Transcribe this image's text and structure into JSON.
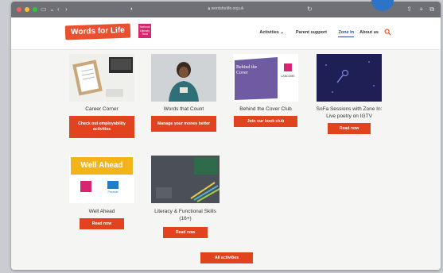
{
  "browser": {
    "url": "wordsforlife.org.uk"
  },
  "header": {
    "logo_text": "Words for Life",
    "partner_logo_text": "National Literacy Trust",
    "nav": [
      {
        "label": "Activities ⌄"
      },
      {
        "label": "Parent support"
      },
      {
        "label": "Zone In"
      },
      {
        "label": "About us"
      }
    ]
  },
  "cards": [
    {
      "caption": "Career Corner",
      "button": "Check out employability activities"
    },
    {
      "caption": "Words that Count",
      "button": "Manage your money better"
    },
    {
      "caption": "Behind the Cover Club",
      "button": "Join our book club",
      "thumb_text": "Behind the Cover",
      "thumb_logo": "LANCOME"
    },
    {
      "caption": "SoFa Sessions with Zone In: Live poetry on IGTV",
      "button": "Read now"
    },
    {
      "caption": "Well Ahead",
      "button": "Read now",
      "thumb_text": "Well Ahead",
      "thumb_logo": "Pearson"
    },
    {
      "caption": "Literacy & Functional Skills (16+)",
      "button": "Read now"
    }
  ],
  "all_button": "All activities",
  "colors": {
    "brand_orange": "#e1431f",
    "nav_active": "#2f4aa6",
    "well_ahead_yellow": "#f2b418",
    "book_club_purple": "#6f5ba1",
    "sofa_navy": "#1d1f55"
  }
}
